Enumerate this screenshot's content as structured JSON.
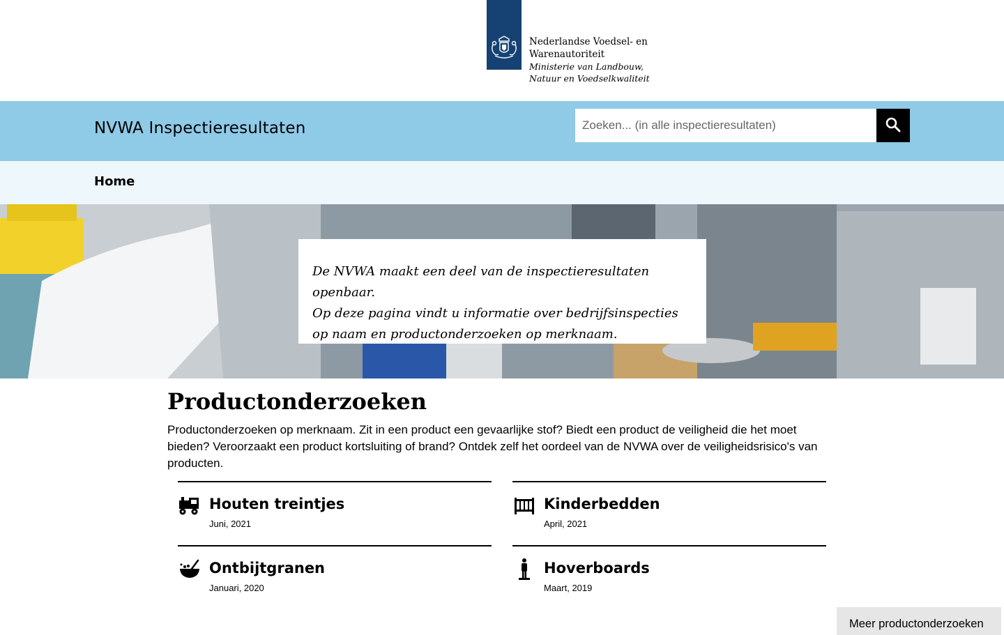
{
  "logo": {
    "line1": "Nederlandse Voedsel- en",
    "line2": "Warenautoriteit",
    "line3": "Ministerie van Landbouw,",
    "line4": "Natuur en Voedselkwaliteit",
    "block_color": "#154273",
    "icon": "coat-of-arms-icon"
  },
  "site": {
    "title": "NVWA Inspectieresultaten",
    "bar_color": "#8fcae7"
  },
  "search": {
    "placeholder": "Zoeken... (in alle inspectieresultaten)",
    "value": "",
    "button_icon": "search-icon"
  },
  "nav": {
    "home_label": "Home",
    "bar_color": "#eef7fc"
  },
  "hero": {
    "intro_line1": "De NVWA maakt een deel van de inspectieresultaten openbaar.",
    "intro_line2": "Op deze pagina vindt u informatie over bedrijfsinspecties op naam en productonderzoeken op merknaam."
  },
  "products": {
    "title": "Productonderzoeken",
    "description": "Productonderzoeken op merknaam. Zit in een product een gevaarlijke stof? Biedt een product de veiligheid die het moet bieden? Veroorzaakt een product kortsluiting of brand? Ontdek zelf het oordeel van de NVWA over de veiligheidsrisico's van producten.",
    "items": [
      {
        "title": "Houten treintjes",
        "date": "Juni, 2021",
        "icon": "train-icon"
      },
      {
        "title": "Kinderbedden",
        "date": "April, 2021",
        "icon": "crib-icon"
      },
      {
        "title": "Ontbijtgranen",
        "date": "Januari, 2020",
        "icon": "cereal-bowl-icon"
      },
      {
        "title": "Hoverboards",
        "date": "Maart, 2019",
        "icon": "hoverboard-icon"
      }
    ],
    "more_label": "Meer productonderzoeken"
  }
}
